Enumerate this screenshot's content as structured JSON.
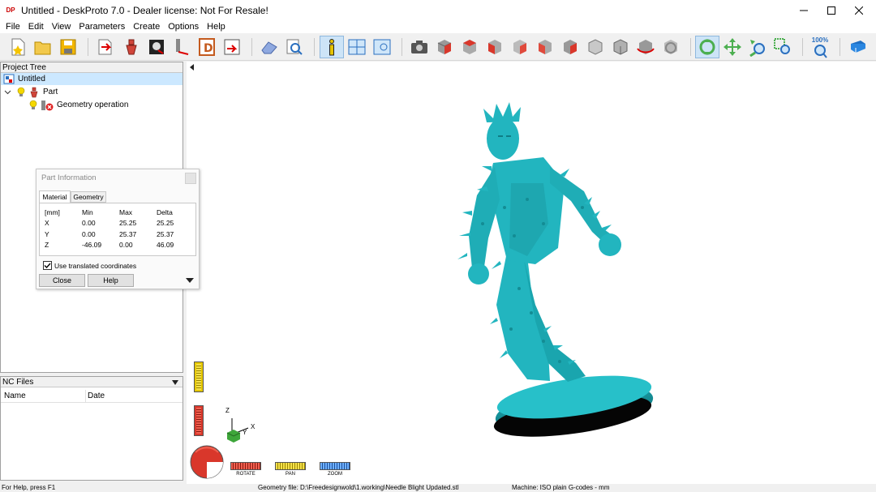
{
  "window": {
    "title": "Untitled - DeskProto 7.0 - Dealer license: Not For Resale!",
    "logo_text": "DP",
    "minimize_icon": "minimize-icon",
    "maximize_icon": "maximize-icon",
    "close_icon": "close-icon"
  },
  "menu": [
    "File",
    "Edit",
    "View",
    "Parameters",
    "Create",
    "Options",
    "Help"
  ],
  "toolbar": {
    "zoom_label": "100%"
  },
  "project_tree": {
    "header": "Project Tree",
    "root": "Untitled",
    "part": "Part",
    "operation": "Geometry operation"
  },
  "nc_files": {
    "header": "NC Files",
    "columns": [
      "Name",
      "Date"
    ]
  },
  "part_info": {
    "title": "Part Information",
    "tabs": [
      "Material",
      "Geometry"
    ],
    "table_header": [
      "[mm]",
      "Min",
      "Max",
      "Delta"
    ],
    "rows": [
      [
        "X",
        "0.00",
        "25.25",
        "25.25"
      ],
      [
        "Y",
        "0.00",
        "25.37",
        "25.37"
      ],
      [
        "Z",
        "-46.09",
        "0.00",
        "46.09"
      ]
    ],
    "checkbox_label": "Use translated coordinates",
    "checkbox_checked": true,
    "close_label": "Close",
    "help_label": "Help"
  },
  "viewport": {
    "axes": {
      "x": "X",
      "y": "Y",
      "z": "Z"
    },
    "nav_labels": {
      "rotate": "ROTATE",
      "pan": "PAN",
      "zoom": "ZOOM"
    },
    "model_color": "#22b5bf"
  },
  "status": {
    "help": "For Help, press F1",
    "geometry": "Geometry file: D:\\Freedesignwold\\1.working\\Needle Blight Updated.stl",
    "machine": "Machine: ISO plain G-codes - mm"
  }
}
